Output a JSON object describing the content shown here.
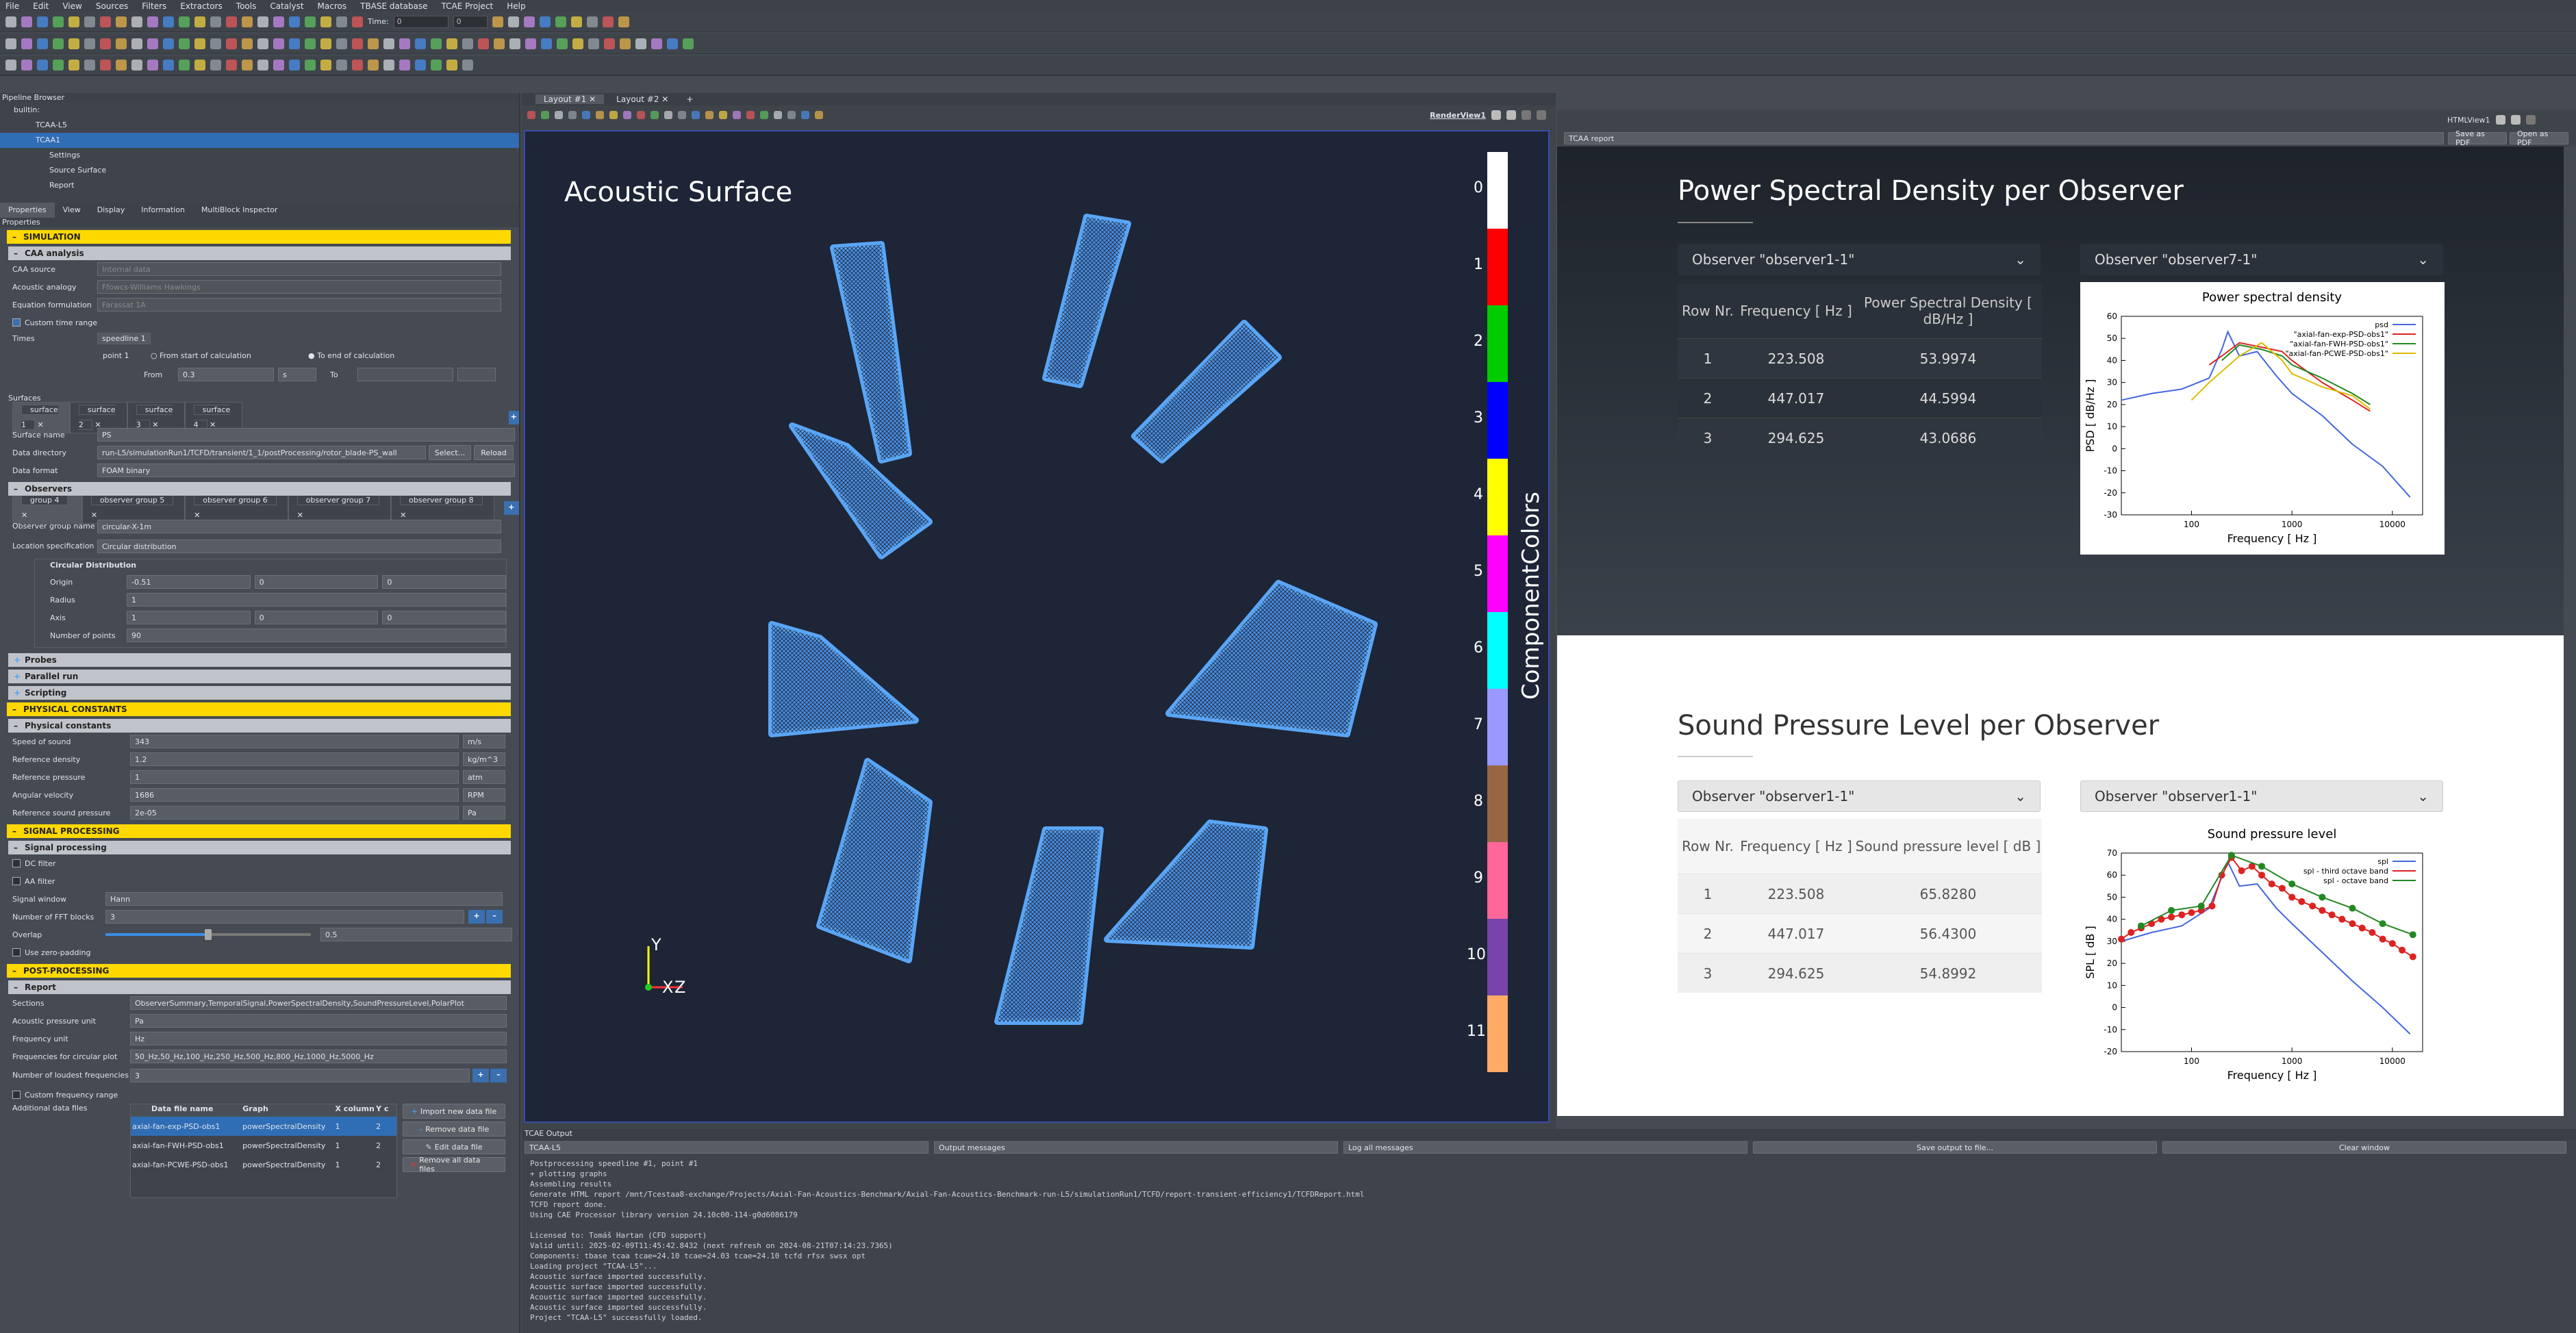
{
  "menu": [
    "File",
    "Edit",
    "View",
    "Sources",
    "Filters",
    "Extractors",
    "Tools",
    "Catalyst",
    "Macros",
    "TBASE database",
    "TCAE Project",
    "Help"
  ],
  "time_toolbar": {
    "label": "Time:",
    "value": "0",
    "index": "0"
  },
  "pipeline": {
    "title": "Pipeline Browser",
    "items": [
      "builtin:",
      "TCAA-L5",
      "TCAA1",
      "Settings",
      "Source Surface",
      "Report"
    ]
  },
  "prop_tabs": [
    "Properties",
    "View",
    "Display",
    "Information",
    "MultiBlock Inspector"
  ],
  "props_title": "Properties",
  "simulation": {
    "title": "SIMULATION",
    "caa_title": "CAA analysis",
    "caa_source_label": "CAA source",
    "caa_source": "Internal data",
    "analogy_label": "Acoustic analogy",
    "analogy": "Ffowcs-Williams Hawkings",
    "equation_label": "Equation formulation",
    "equation": "Farassat 1A",
    "custom_time": "Custom time range",
    "times_label": "Times",
    "speedline": "speedline 1",
    "point": "point 1",
    "from_start": "From start of calculation",
    "to_end": "To end of calculation",
    "from_label": "From",
    "from_value": "0.3",
    "unit_s": "s",
    "to_label": "To",
    "surfaces_label": "Surfaces",
    "surface_tabs": [
      "surface 1",
      "surface 2",
      "surface 3",
      "surface 4"
    ],
    "surface_name_label": "Surface name",
    "surface_name": "PS",
    "data_dir_label": "Data directory",
    "data_dir": "run-L5/simulationRun1/TCFD/transient/1_1/postProcessing/rotor_blade-PS_wall",
    "select": "Select...",
    "reload": "Reload",
    "data_format_label": "Data format",
    "data_format": "FOAM binary",
    "observers_title": "Observers",
    "observer_tabs": [
      "group 4",
      "observer group 5",
      "observer group 6",
      "observer group 7",
      "observer group 8"
    ],
    "obs_group_name_label": "Observer group name",
    "obs_group_name": "circular-X-1m",
    "location_label": "Location specification",
    "location": "Circular distribution",
    "circ_title": "Circular Distribution",
    "origin_label": "Origin",
    "origin": [
      "-0.51",
      "0",
      "0"
    ],
    "radius_label": "Radius",
    "radius": "1",
    "axis_label": "Axis",
    "axis": [
      "1",
      "0",
      "0"
    ],
    "npoints_label": "Number of points",
    "npoints": "90",
    "probes": "Probes",
    "parallel": "Parallel run",
    "scripting": "Scripting"
  },
  "physical": {
    "title": "PHYSICAL CONSTANTS",
    "sub": "Physical constants",
    "rows": [
      {
        "label": "Speed of sound",
        "value": "343",
        "unit": "m/s"
      },
      {
        "label": "Reference density",
        "value": "1.2",
        "unit": "kg/m^3"
      },
      {
        "label": "Reference pressure",
        "value": "1",
        "unit": "atm"
      },
      {
        "label": "Angular velocity",
        "value": "1686",
        "unit": "RPM"
      },
      {
        "label": "Reference sound pressure",
        "value": "2e-05",
        "unit": "Pa"
      }
    ]
  },
  "signal": {
    "title": "SIGNAL PROCESSING",
    "sub": "Signal processing",
    "dc": "DC filter",
    "aa": "AA filter",
    "window_label": "Signal window",
    "window": "Hann",
    "fft_label": "Number of FFT blocks",
    "fft": "3",
    "overlap_label": "Overlap",
    "overlap": "0.5",
    "overlap_fraction": 0.5,
    "zero": "Use zero-padding"
  },
  "post": {
    "title": "POST-PROCESSING",
    "sub": "Report",
    "sections_label": "Sections",
    "sections": "ObserverSummary,TemporalSignal,PowerSpectralDensity,SoundPressureLevel,PolarPlot",
    "pressure_unit_label": "Acoustic pressure unit",
    "pressure_unit": "Pa",
    "freq_unit_label": "Frequency unit",
    "freq_unit": "Hz",
    "circ_freq_label": "Frequencies for circular plot",
    "circ_freq": "50_Hz,50_Hz,100_Hz,250_Hz,500_Hz,800_Hz,1000_Hz,5000_Hz",
    "loudest_label": "Number of loudest frequencies",
    "loudest": "3",
    "custom_freq": "Custom frequency range",
    "add_files_label": "Additional data files",
    "file_headers": [
      "Data file name",
      "Graph",
      "X column",
      "Y c"
    ],
    "files": [
      {
        "name": "axial-fan-exp-PSD-obs1",
        "graph": "powerSpectralDensity",
        "x": "1",
        "y": "2"
      },
      {
        "name": "axial-fan-FWH-PSD-obs1",
        "graph": "powerSpectralDensity",
        "x": "1",
        "y": "2"
      },
      {
        "name": "axial-fan-PCWE-PSD-obs1",
        "graph": "powerSpectralDensity",
        "x": "1",
        "y": "2"
      }
    ],
    "import": "Import new data file",
    "remove": "Remove data file",
    "edit": "Edit data file",
    "remove_all": "Remove all data files"
  },
  "layout_tabs": [
    "Layout #1",
    "Layout #2",
    "+"
  ],
  "render_view": "RenderView1",
  "render": {
    "title": "Acoustic Surface",
    "colorbar_title": "ComponentColors",
    "axes": {
      "y": "Y",
      "x": "X",
      "z": "Z"
    },
    "colors": [
      "#ffffff",
      "#ff0000",
      "#00cc00",
      "#0000ff",
      "#ffff00",
      "#ff00ff",
      "#00ffff",
      "#9999ff",
      "#996644",
      "#ff6699",
      "#7744aa",
      "#ffaa66"
    ],
    "labels": [
      "0",
      "1",
      "2",
      "3",
      "4",
      "5",
      "6",
      "7",
      "8",
      "9",
      "10",
      "11"
    ]
  },
  "html_view": {
    "label": "HTMLView1",
    "report_select": "TCAA report",
    "save_pdf": "Save as PDF",
    "open_pdf": "Open as PDF"
  },
  "psd_section": {
    "title": "Power Spectral Density per Observer",
    "select1": "Observer \"observer1-1\"",
    "select2": "Observer \"observer7-1\"",
    "head": [
      "Row Nr.",
      "Frequency [ Hz ]",
      "Power Spectral Density [ dB/Hz ]"
    ],
    "rows": [
      [
        "1",
        "223.508",
        "53.9974"
      ],
      [
        "2",
        "447.017",
        "44.5994"
      ],
      [
        "3",
        "294.625",
        "43.0686"
      ]
    ]
  },
  "spl_section": {
    "title": "Sound Pressure Level per Observer",
    "select1": "Observer \"observer1-1\"",
    "select2": "Observer \"observer1-1\"",
    "head": [
      "Row Nr.",
      "Frequency [ Hz ]",
      "Sound pressure level [ dB ]"
    ],
    "rows": [
      [
        "1",
        "223.508",
        "65.8280"
      ],
      [
        "2",
        "447.017",
        "56.4300"
      ],
      [
        "3",
        "294.625",
        "54.8992"
      ]
    ]
  },
  "chart_data": [
    {
      "type": "line",
      "title": "Power spectral density",
      "xlabel": "Frequency [ Hz ]",
      "ylabel": "PSD [ dB/Hz ]",
      "xscale": "log",
      "xlim": [
        20,
        20000
      ],
      "ylim": [
        -30,
        60
      ],
      "xticks": [
        "100",
        "1000",
        "10000"
      ],
      "yticks": [
        "-30",
        "-20",
        "-10",
        "0",
        "10",
        "20",
        "30",
        "40",
        "50",
        "60"
      ],
      "legend": "top-right",
      "series": [
        {
          "name": "psd",
          "color": "#4466dd",
          "x": [
            20,
            40,
            80,
            150,
            200,
            230,
            300,
            450,
            700,
            1000,
            2000,
            4000,
            8000,
            15000
          ],
          "y": [
            22,
            25,
            27,
            32,
            45,
            53,
            42,
            44,
            33,
            25,
            15,
            2,
            -8,
            -22
          ]
        },
        {
          "name": "\"axial-fan-exp-PSD-obs1\"",
          "color": "#dd2222",
          "x": [
            150,
            200,
            300,
            500,
            800,
            1000,
            2000,
            4000,
            6000
          ],
          "y": [
            38,
            42,
            48,
            46,
            44,
            40,
            30,
            22,
            17
          ]
        },
        {
          "name": "\"axial-fan-FWH-PSD-obs1\"",
          "color": "#228822",
          "x": [
            200,
            300,
            500,
            800,
            1000,
            2000,
            4000,
            6000
          ],
          "y": [
            40,
            47,
            45,
            42,
            38,
            32,
            25,
            20
          ]
        },
        {
          "name": "\"axial-fan-PCWE-PSD-obs1\"",
          "color": "#ddbb00",
          "x": [
            100,
            150,
            300,
            500,
            800,
            1000,
            2000,
            4000,
            6000
          ],
          "y": [
            22,
            30,
            42,
            48,
            40,
            34,
            28,
            24,
            18
          ]
        }
      ]
    },
    {
      "type": "line",
      "title": "Sound pressure level",
      "xlabel": "Frequency [ Hz ]",
      "ylabel": "SPL [ dB ]",
      "xscale": "log",
      "xlim": [
        20,
        20000
      ],
      "ylim": [
        -20,
        70
      ],
      "xticks": [
        "100",
        "1000",
        "10000"
      ],
      "yticks": [
        "-20",
        "-10",
        "0",
        "10",
        "20",
        "30",
        "40",
        "50",
        "60",
        "70"
      ],
      "legend": "top-right",
      "series": [
        {
          "name": "spl",
          "color": "#4466dd",
          "x": [
            20,
            40,
            80,
            150,
            230,
            300,
            450,
            700,
            1000,
            2000,
            4000,
            8000,
            15000
          ],
          "y": [
            30,
            34,
            37,
            45,
            66,
            55,
            56,
            45,
            38,
            25,
            12,
            0,
            -12
          ]
        },
        {
          "name": "spl - third octave band",
          "color": "#dd2222",
          "x": [
            20,
            25,
            31.5,
            40,
            50,
            63,
            80,
            100,
            125,
            160,
            200,
            250,
            315,
            400,
            500,
            630,
            800,
            1000,
            1250,
            1600,
            2000,
            2500,
            3150,
            4000,
            5000,
            6300,
            8000,
            10000,
            12500,
            16000
          ],
          "y": [
            31,
            34,
            36,
            38,
            40,
            41,
            42,
            43,
            44,
            46,
            60,
            68,
            62,
            64,
            60,
            56,
            54,
            50,
            48,
            46,
            44,
            42,
            40,
            38,
            36,
            34,
            31,
            29,
            26,
            23
          ]
        },
        {
          "name": "spl - octave band",
          "color": "#228822",
          "x": [
            31.5,
            63,
            125,
            250,
            500,
            1000,
            2000,
            4000,
            8000,
            16000
          ],
          "y": [
            37,
            44,
            46,
            69,
            64,
            56,
            50,
            45,
            38,
            33
          ]
        }
      ]
    }
  ],
  "output": {
    "title": "TCAE Output",
    "select": "TCAA-L5",
    "type": "Output messages",
    "log": "Log all messages",
    "save": "Save output to file...",
    "clear": "Clear window",
    "lines": [
      "Postprocessing speedline #1, point #1",
      " + plotting graphs",
      "Assembling results",
      "Generate HTML report /mnt/Tcestaa8-exchange/Projects/Axial-Fan-Acoustics-Benchmark/Axial-Fan-Acoustics-Benchmark-run-L5/simulationRun1/TCFD/report-transient-efficiency1/TCFDReport.html",
      "TCFD report done.",
      "Using CAE Processor library version 24.10c00-114-g0d6086179",
      "",
      "Licensed to: Tomáš Hartan (CFD support)",
      "Valid until: 2025-02-09T11:45:42.8432 (next refresh on 2024-08-21T07:14:23.7365)",
      "Components:  tbase tcaa tcae=24.10 tcae=24.03 tcae=24.10 tcfd rfsx swsx opt",
      "Loading project \"TCAA-L5\"...",
      "Acoustic surface imported successfully.",
      "Acoustic surface imported successfully.",
      "Acoustic surface imported successfully.",
      "Acoustic surface imported successfully.",
      "Project \"TCAA-L5\" successfully loaded."
    ]
  }
}
